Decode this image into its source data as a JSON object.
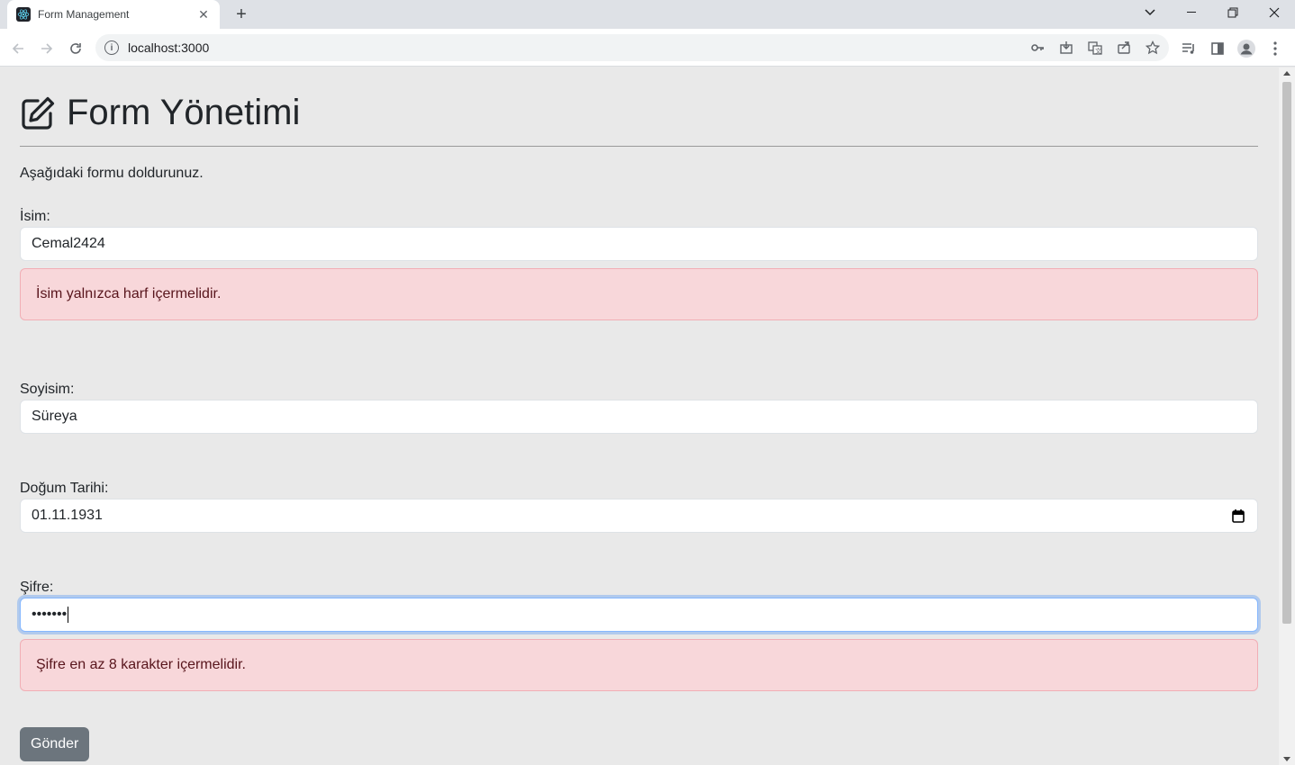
{
  "browser": {
    "tab_title": "Form Management",
    "url": "localhost:3000"
  },
  "page": {
    "title": "Form Yönetimi",
    "intro": "Aşağıdaki formu doldurunuz.",
    "fields": {
      "name": {
        "label": "İsim:",
        "value": "Cemal2424",
        "error": "İsim yalnızca harf içermelidir."
      },
      "surname": {
        "label": "Soyisim:",
        "value": "Süreya"
      },
      "birthdate": {
        "label": "Doğum Tarihi:",
        "value": "01.11.1931"
      },
      "password": {
        "label": "Şifre:",
        "value": "•••••••",
        "error": "Şifre en az 8 karakter içermelidir."
      }
    },
    "submit_label": "Gönder"
  }
}
